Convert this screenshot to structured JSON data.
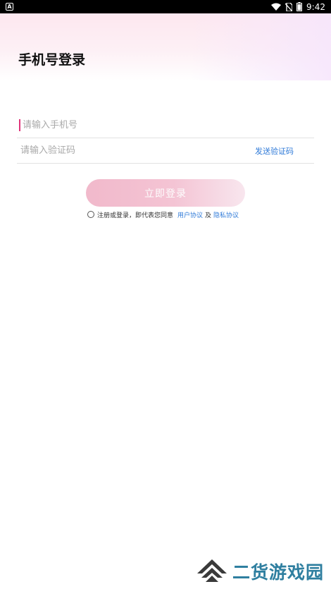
{
  "status_bar": {
    "notification_glyph": "A",
    "time": "9:42",
    "icons": [
      "wifi-icon",
      "no-sim-icon",
      "battery-icon"
    ]
  },
  "header": {
    "title": "手机号登录"
  },
  "form": {
    "phone_placeholder": "请输入手机号",
    "code_placeholder": "请输入验证码",
    "send_code_label": "发送验证码",
    "login_label": "立即登录"
  },
  "agreement": {
    "prefix": "注册或登录，即代表您同意",
    "user_agreement": "用户协议",
    "and": "及",
    "privacy_policy": "隐私协议"
  },
  "watermark": {
    "text": "二货游戏园"
  },
  "colors": {
    "accent_link": "#2f7ad8",
    "cursor": "#e0357a",
    "button_start": "#f1b9cb",
    "button_end": "#f8e6ee",
    "watermark": "#2f7fa0"
  }
}
